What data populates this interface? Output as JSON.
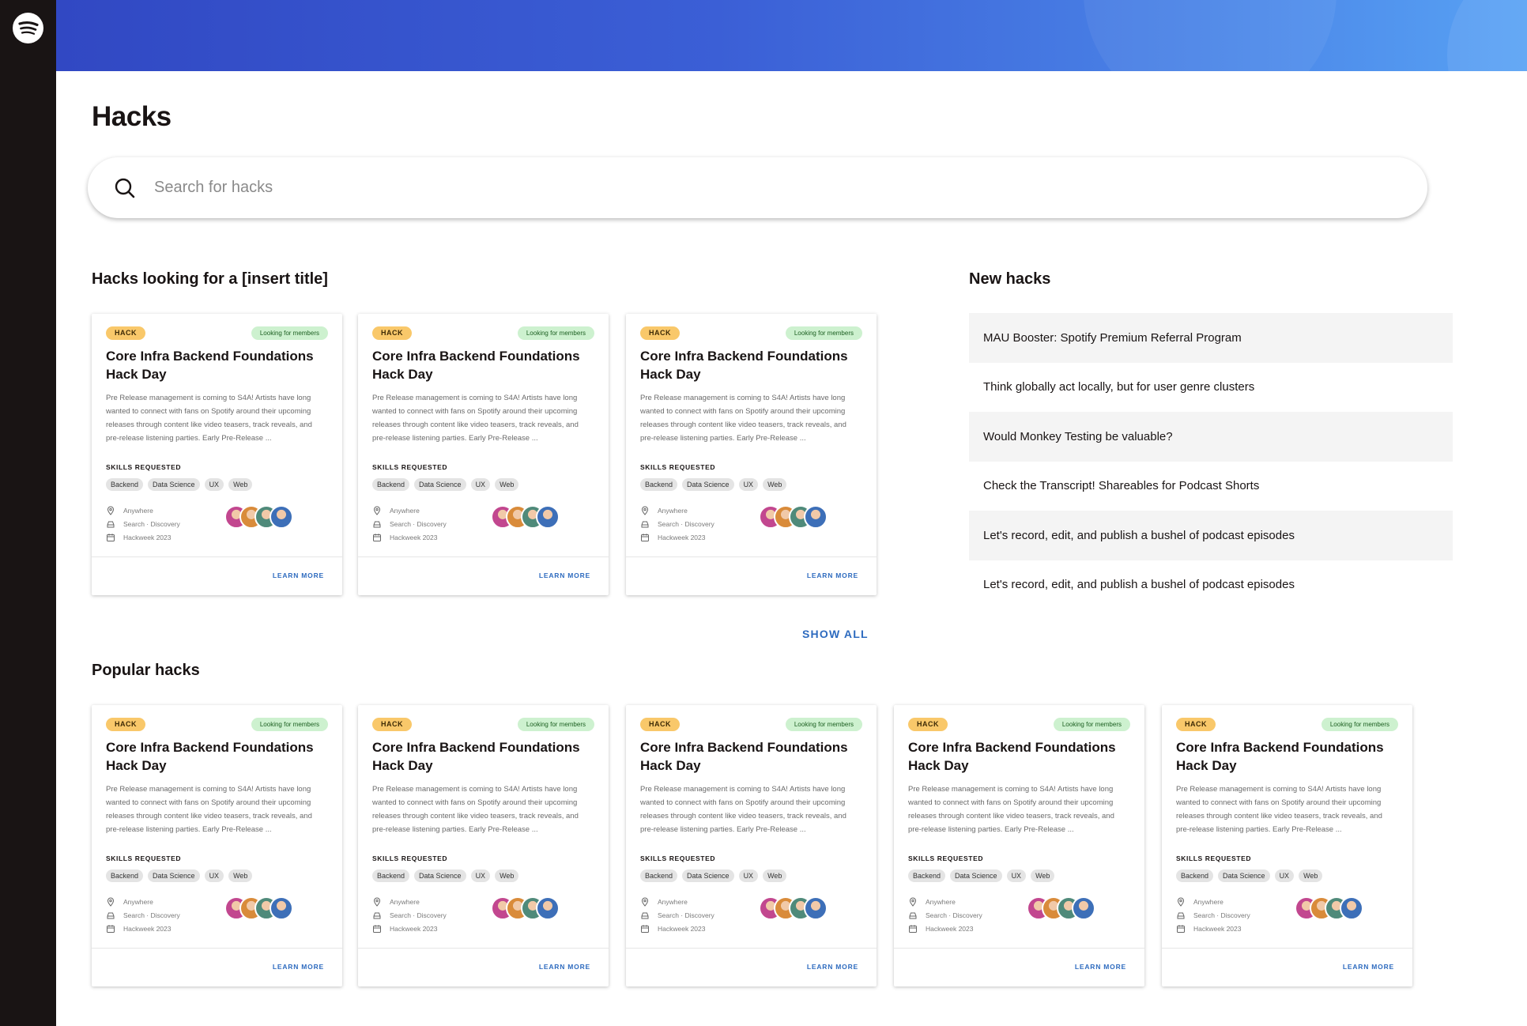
{
  "page": {
    "title": "Hacks"
  },
  "search": {
    "placeholder": "Search for hacks",
    "value": ""
  },
  "sections": {
    "looking_title": "Hacks looking for a [insert title]",
    "new_title": "New hacks",
    "popular_title": "Popular hacks",
    "show_all": "SHOW ALL"
  },
  "card": {
    "badge": "HACK",
    "status": "Looking for members",
    "title": "Core Infra Backend Foundations Hack Day",
    "description": "Pre Release management is coming to S4A! Artists have long wanted to connect with fans on Spotify around their upcoming releases through content like video teasers, track reveals, and pre-release listening parties. Early Pre-Release ...",
    "skills_label": "SKILLS REQUESTED",
    "skills": [
      "Backend",
      "Data Science",
      "UX",
      "Web"
    ],
    "location": "Anywhere",
    "team": "Search · Discovery",
    "event": "Hackweek 2023",
    "learn_more": "LEARN MORE",
    "avatar_colors": [
      "#c2478f",
      "#d98b3a",
      "#4f8a7a",
      "#3d6fb8"
    ]
  },
  "new_hacks": [
    "MAU Booster: Spotify Premium Referral Program",
    "Think globally act locally, but for user genre clusters",
    "Would Monkey Testing be valuable?",
    "Check the Transcript! Shareables for Podcast Shorts",
    "Let's record, edit, and publish a bushel of podcast episodes",
    "Let's record, edit, and publish a bushel of podcast episodes"
  ],
  "colors": {
    "sidebar": "#191414",
    "accent_link": "#2e6bbf",
    "hack_badge": "#f9c86a",
    "status_badge": "#cdf1cf"
  },
  "icons": [
    "spotify-logo-icon",
    "search-icon",
    "location-pin-icon",
    "team-icon",
    "calendar-icon"
  ]
}
